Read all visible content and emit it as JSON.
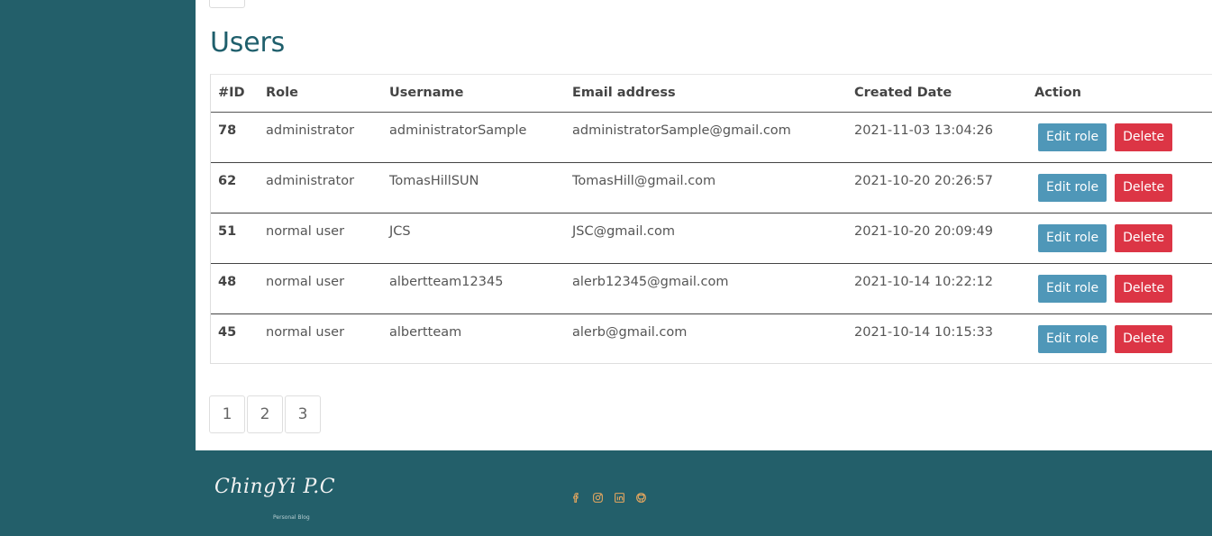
{
  "page": {
    "title": "Users"
  },
  "table": {
    "headers": {
      "id": "#ID",
      "role": "Role",
      "username": "Username",
      "email": "Email address",
      "created": "Created Date",
      "action": "Action"
    },
    "rows": [
      {
        "id": "78",
        "role": "administrator",
        "username": "administratorSample",
        "email": "administratorSample@gmail.com",
        "created": "2021-11-03 13:04:26",
        "edit": "Edit role",
        "delete": "Delete"
      },
      {
        "id": "62",
        "role": "administrator",
        "username": "TomasHillSUN",
        "email": "TomasHill@gmail.com",
        "created": "2021-10-20 20:26:57",
        "edit": "Edit role",
        "delete": "Delete"
      },
      {
        "id": "51",
        "role": "normal user",
        "username": "JCS",
        "email": "JSC@gmail.com",
        "created": "2021-10-20 20:09:49",
        "edit": "Edit role",
        "delete": "Delete"
      },
      {
        "id": "48",
        "role": "normal user",
        "username": "albertteam12345",
        "email": "alerb12345@gmail.com",
        "created": "2021-10-14 10:22:12",
        "edit": "Edit role",
        "delete": "Delete"
      },
      {
        "id": "45",
        "role": "normal user",
        "username": "albertteam",
        "email": "alerb@gmail.com",
        "created": "2021-10-14 10:15:33",
        "edit": "Edit role",
        "delete": "Delete"
      }
    ]
  },
  "pagination": {
    "pages": [
      "1",
      "2",
      "3"
    ]
  },
  "footer": {
    "logo_text": "ChingYi P.C",
    "tagline": "Personal Blog",
    "social_icons": [
      "facebook-icon",
      "instagram-icon",
      "linkedin-icon",
      "github-icon"
    ],
    "icon_color": "#e6a75f"
  },
  "colors": {
    "background": "#235f6a",
    "title": "#1f5f6c",
    "edit_button": "#4f97b8",
    "delete_button": "#dc3545"
  }
}
